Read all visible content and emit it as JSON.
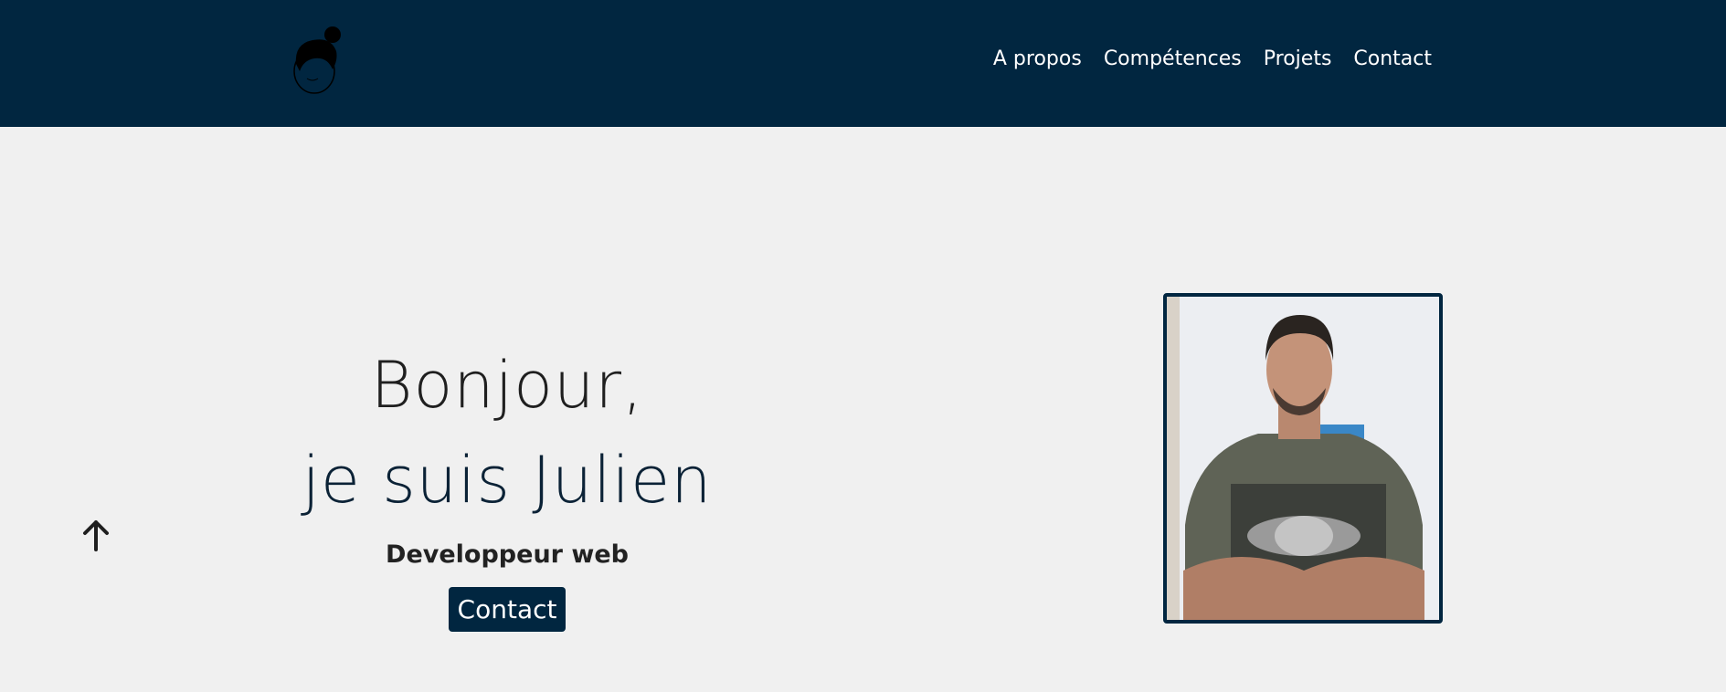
{
  "header": {
    "logo_icon": "face-logo-icon",
    "nav": [
      {
        "label": "A propos"
      },
      {
        "label": "Compétences"
      },
      {
        "label": "Projets"
      },
      {
        "label": "Contact"
      }
    ]
  },
  "hero": {
    "line1": "Bonjour,",
    "line2": "je suis Julien",
    "subtitle": "Developpeur web",
    "cta_label": "Contact"
  },
  "scroll_top_icon": "arrow-up-icon",
  "colors": {
    "brand": "#012640",
    "background": "#f0f0f0",
    "text": "#1f1f1f"
  }
}
